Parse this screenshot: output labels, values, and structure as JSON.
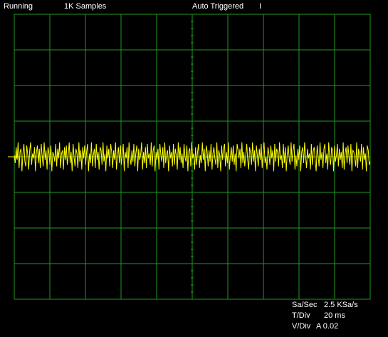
{
  "status": {
    "run_state": "Running",
    "samples": "1K Samples",
    "trigger_mode": "Auto Triggered",
    "trigger_marker": "I"
  },
  "readouts": {
    "sa_sec_label": "Sa/Sec",
    "sa_sec_value": "2.5 KSa/s",
    "t_div_label": "T/Div",
    "t_div_value": "20 ms",
    "v_div_label": "V/Div",
    "v_div_value": "A 0.02"
  },
  "colors": {
    "background": "#000000",
    "grid": "#1e9a1e",
    "trace": "#ffff00",
    "text": "#ffffff"
  },
  "chart_data": {
    "type": "line",
    "title": "",
    "xlabel": "",
    "ylabel": "",
    "x_divisions": 10,
    "y_divisions": 8,
    "grid": true,
    "trace_center_div": 3,
    "trace_amplitude_div": 0.45,
    "series": [
      {
        "color": "#ffff00",
        "values": [
          0.1,
          -0.4,
          0.6,
          -0.2,
          0.9,
          -0.7,
          0.3,
          0.5,
          -0.9,
          0.2,
          0.8,
          -0.3,
          -0.6,
          0.7,
          0.1,
          -0.8,
          0.4,
          0.9,
          -0.5,
          0.2,
          -0.1,
          0.6,
          -0.9,
          0.3,
          0.7,
          -0.4,
          0.5,
          -0.7,
          0.8,
          0.0,
          -0.6,
          0.9,
          -0.2,
          0.4,
          -0.8,
          0.6,
          0.2,
          -0.5,
          0.7,
          -0.9,
          0.3,
          0.1,
          -0.3,
          0.8,
          -0.6,
          0.5,
          -0.1,
          0.9,
          -0.7,
          0.2,
          0.4,
          -0.8,
          0.6,
          -0.2,
          0.7,
          -0.5,
          0.1,
          0.9,
          -0.4,
          0.3,
          -0.9,
          0.8,
          0.0,
          -0.6,
          0.5,
          0.2,
          -0.7,
          0.9,
          -0.3,
          0.4,
          -0.8,
          0.6,
          -0.1,
          0.7,
          -0.5,
          0.3,
          0.8,
          -0.9,
          0.2,
          -0.4,
          0.9,
          -0.6,
          0.1,
          0.5,
          -0.7,
          0.8,
          -0.2,
          0.3,
          -0.8,
          0.6,
          0.4,
          -0.5,
          0.9,
          -0.3,
          0.2,
          -0.9,
          0.7,
          -0.1,
          0.5,
          -0.6,
          0.8,
          0.3,
          -0.7,
          0.4,
          -0.2,
          0.9,
          -0.8,
          0.1,
          0.6,
          -0.4,
          0.7,
          -0.5,
          0.2,
          0.8,
          -0.9,
          0.3,
          -0.1,
          0.6,
          -0.7,
          0.9,
          0.0,
          -0.5,
          0.4,
          -0.3,
          0.8,
          -0.6,
          0.2,
          0.7,
          -0.9,
          0.5,
          -0.2,
          0.1,
          0.9,
          -0.8,
          0.3,
          -0.4,
          0.6,
          -0.7,
          0.8,
          -0.1,
          0.2,
          -0.5,
          0.9,
          -0.6,
          0.4,
          0.7,
          -0.9,
          0.3,
          -0.2,
          0.5,
          -0.8,
          0.8,
          0.1,
          -0.3,
          0.6,
          -0.7,
          0.9,
          -0.4,
          0.2,
          0.4,
          -0.9,
          0.7,
          -0.1,
          0.3,
          -0.6,
          0.8,
          -0.5,
          0.5,
          0.1,
          -0.8,
          0.9,
          -0.2,
          0.6,
          -0.4,
          0.2,
          -0.7,
          0.8,
          0.0,
          -0.3,
          0.7,
          -0.9,
          0.4,
          0.5,
          -0.6,
          0.9,
          -0.1,
          0.2,
          -0.8,
          0.6,
          -0.5,
          0.3,
          0.8,
          -0.7,
          0.1,
          -0.4,
          0.9,
          -0.2,
          0.5,
          -0.9,
          0.7,
          0.3,
          -0.6,
          0.4,
          -0.3,
          0.8,
          -0.8,
          0.2,
          0.6,
          -0.1,
          -0.5,
          0.9,
          -0.7,
          0.4,
          0.1,
          -0.9,
          0.7,
          -0.2,
          0.5,
          0.8,
          -0.6,
          0.3,
          -0.4,
          0.9,
          -0.8,
          0.0,
          0.6,
          -0.3,
          0.7,
          -0.5,
          0.2,
          -0.9,
          0.8,
          0.4,
          -0.1,
          0.5,
          -0.7,
          0.9,
          -0.4,
          0.3,
          -0.6,
          0.1,
          0.8,
          -0.2,
          -0.8,
          0.6,
          0.2,
          -0.5,
          0.9,
          -0.3,
          0.4,
          -0.9,
          0.7,
          0.1,
          -0.6,
          0.5,
          -0.2,
          0.8,
          -0.7,
          0.3,
          0.9,
          -0.4,
          0.0,
          -0.8,
          0.6,
          0.2,
          -0.5,
          0.7,
          -0.1,
          0.4,
          -0.9,
          0.8,
          -0.3,
          0.5,
          0.3,
          -0.6,
          0.9,
          -0.2,
          0.1,
          -0.7,
          0.8,
          -0.4,
          0.6,
          -0.9,
          0.2,
          0.7,
          -0.1,
          -0.5,
          0.9,
          -0.3,
          0.4,
          0.8,
          -0.8,
          0.1,
          -0.6,
          0.5,
          -0.2,
          0.7,
          -0.9,
          0.3,
          0.6,
          -0.4,
          0.9,
          0.0,
          -0.7,
          0.5,
          -0.1,
          0.2,
          -0.8,
          0.8,
          -0.5,
          0.4,
          0.6,
          -0.3,
          -0.9,
          0.7,
          0.1,
          -0.6,
          0.9,
          -0.2,
          0.3,
          -0.7,
          0.5,
          0.8,
          -0.4,
          0.2,
          -0.8,
          0.9,
          -0.1,
          -0.5,
          0.6,
          0.4,
          -0.9,
          0.7,
          -0.3,
          0.1,
          0.8,
          -0.6,
          0.5,
          -0.2,
          0.3,
          -0.7,
          0.9,
          -0.8,
          0.2,
          0.6,
          -0.4,
          0.7,
          0.0,
          -0.5,
          0.8,
          -0.9,
          0.4,
          0.3,
          -0.1,
          -0.6,
          0.9,
          -0.7,
          0.5,
          0.1,
          -0.3,
          0.8,
          -0.8,
          0.6,
          -0.2,
          0.2,
          -0.9,
          0.7,
          0.4,
          -0.5,
          -0.3
        ]
      }
    ]
  }
}
